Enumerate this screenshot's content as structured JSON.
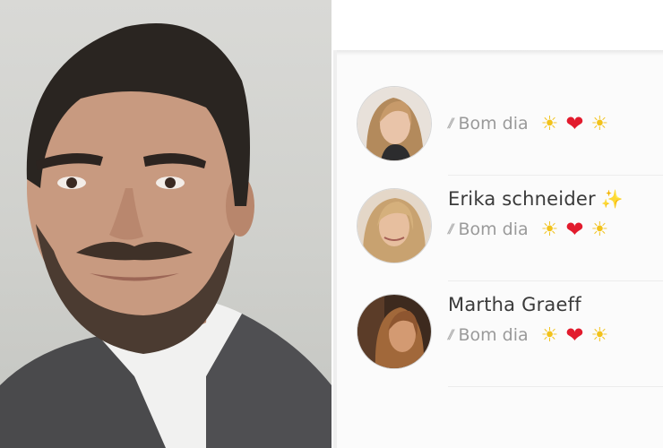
{
  "portrait": {
    "alt": "man portrait"
  },
  "chats": [
    {
      "name": "",
      "sparkle": "",
      "ticks": "//",
      "message": "Bom dia",
      "emoji": [
        "sun-emoji",
        "heart-emoji",
        "sun-emoji"
      ]
    },
    {
      "name": "Erika schneider",
      "sparkle": "✨",
      "ticks": "//",
      "message": "Bom dia",
      "emoji": [
        "sun-emoji",
        "heart-emoji",
        "sun-emoji"
      ]
    },
    {
      "name": "Martha Graeff",
      "sparkle": "",
      "ticks": "//",
      "message": "Bom dia",
      "emoji": [
        "sun-emoji",
        "heart-emoji",
        "sun-emoji"
      ]
    }
  ],
  "glyphs": {
    "sun": "☀",
    "heart": "❤"
  },
  "colors": {
    "sun": "#f2c21a",
    "heart": "#e21b2d",
    "sparkle": "#f2c744"
  }
}
